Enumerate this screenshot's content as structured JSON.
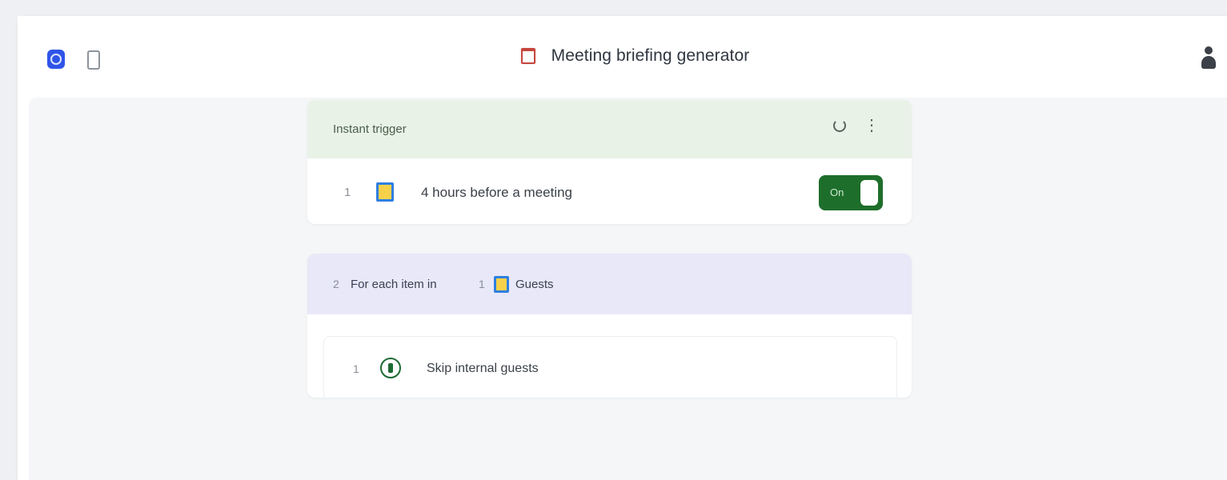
{
  "header": {
    "title": "Meeting briefing generator"
  },
  "trigger": {
    "label": "Instant trigger",
    "step_number": "1",
    "step_text": "4 hours before a meeting",
    "toggle_label": "On"
  },
  "loop": {
    "step_number": "2",
    "text": "For each item in",
    "ref_number": "1",
    "ref_label": "Guests",
    "inner": {
      "step_number": "1",
      "text": "Skip internal guests"
    }
  },
  "colors": {
    "accent": "#2f55e8",
    "trigger_header": "#e9f2e7",
    "loop_header": "#e8e8f8",
    "toggle_on": "#1e6e2b"
  },
  "icons": [
    "app-logo-icon",
    "sidebar-toggle-icon",
    "calendar-icon",
    "user-icon",
    "refresh-icon",
    "more-icon",
    "google-calendar-icon",
    "filter-icon"
  ]
}
